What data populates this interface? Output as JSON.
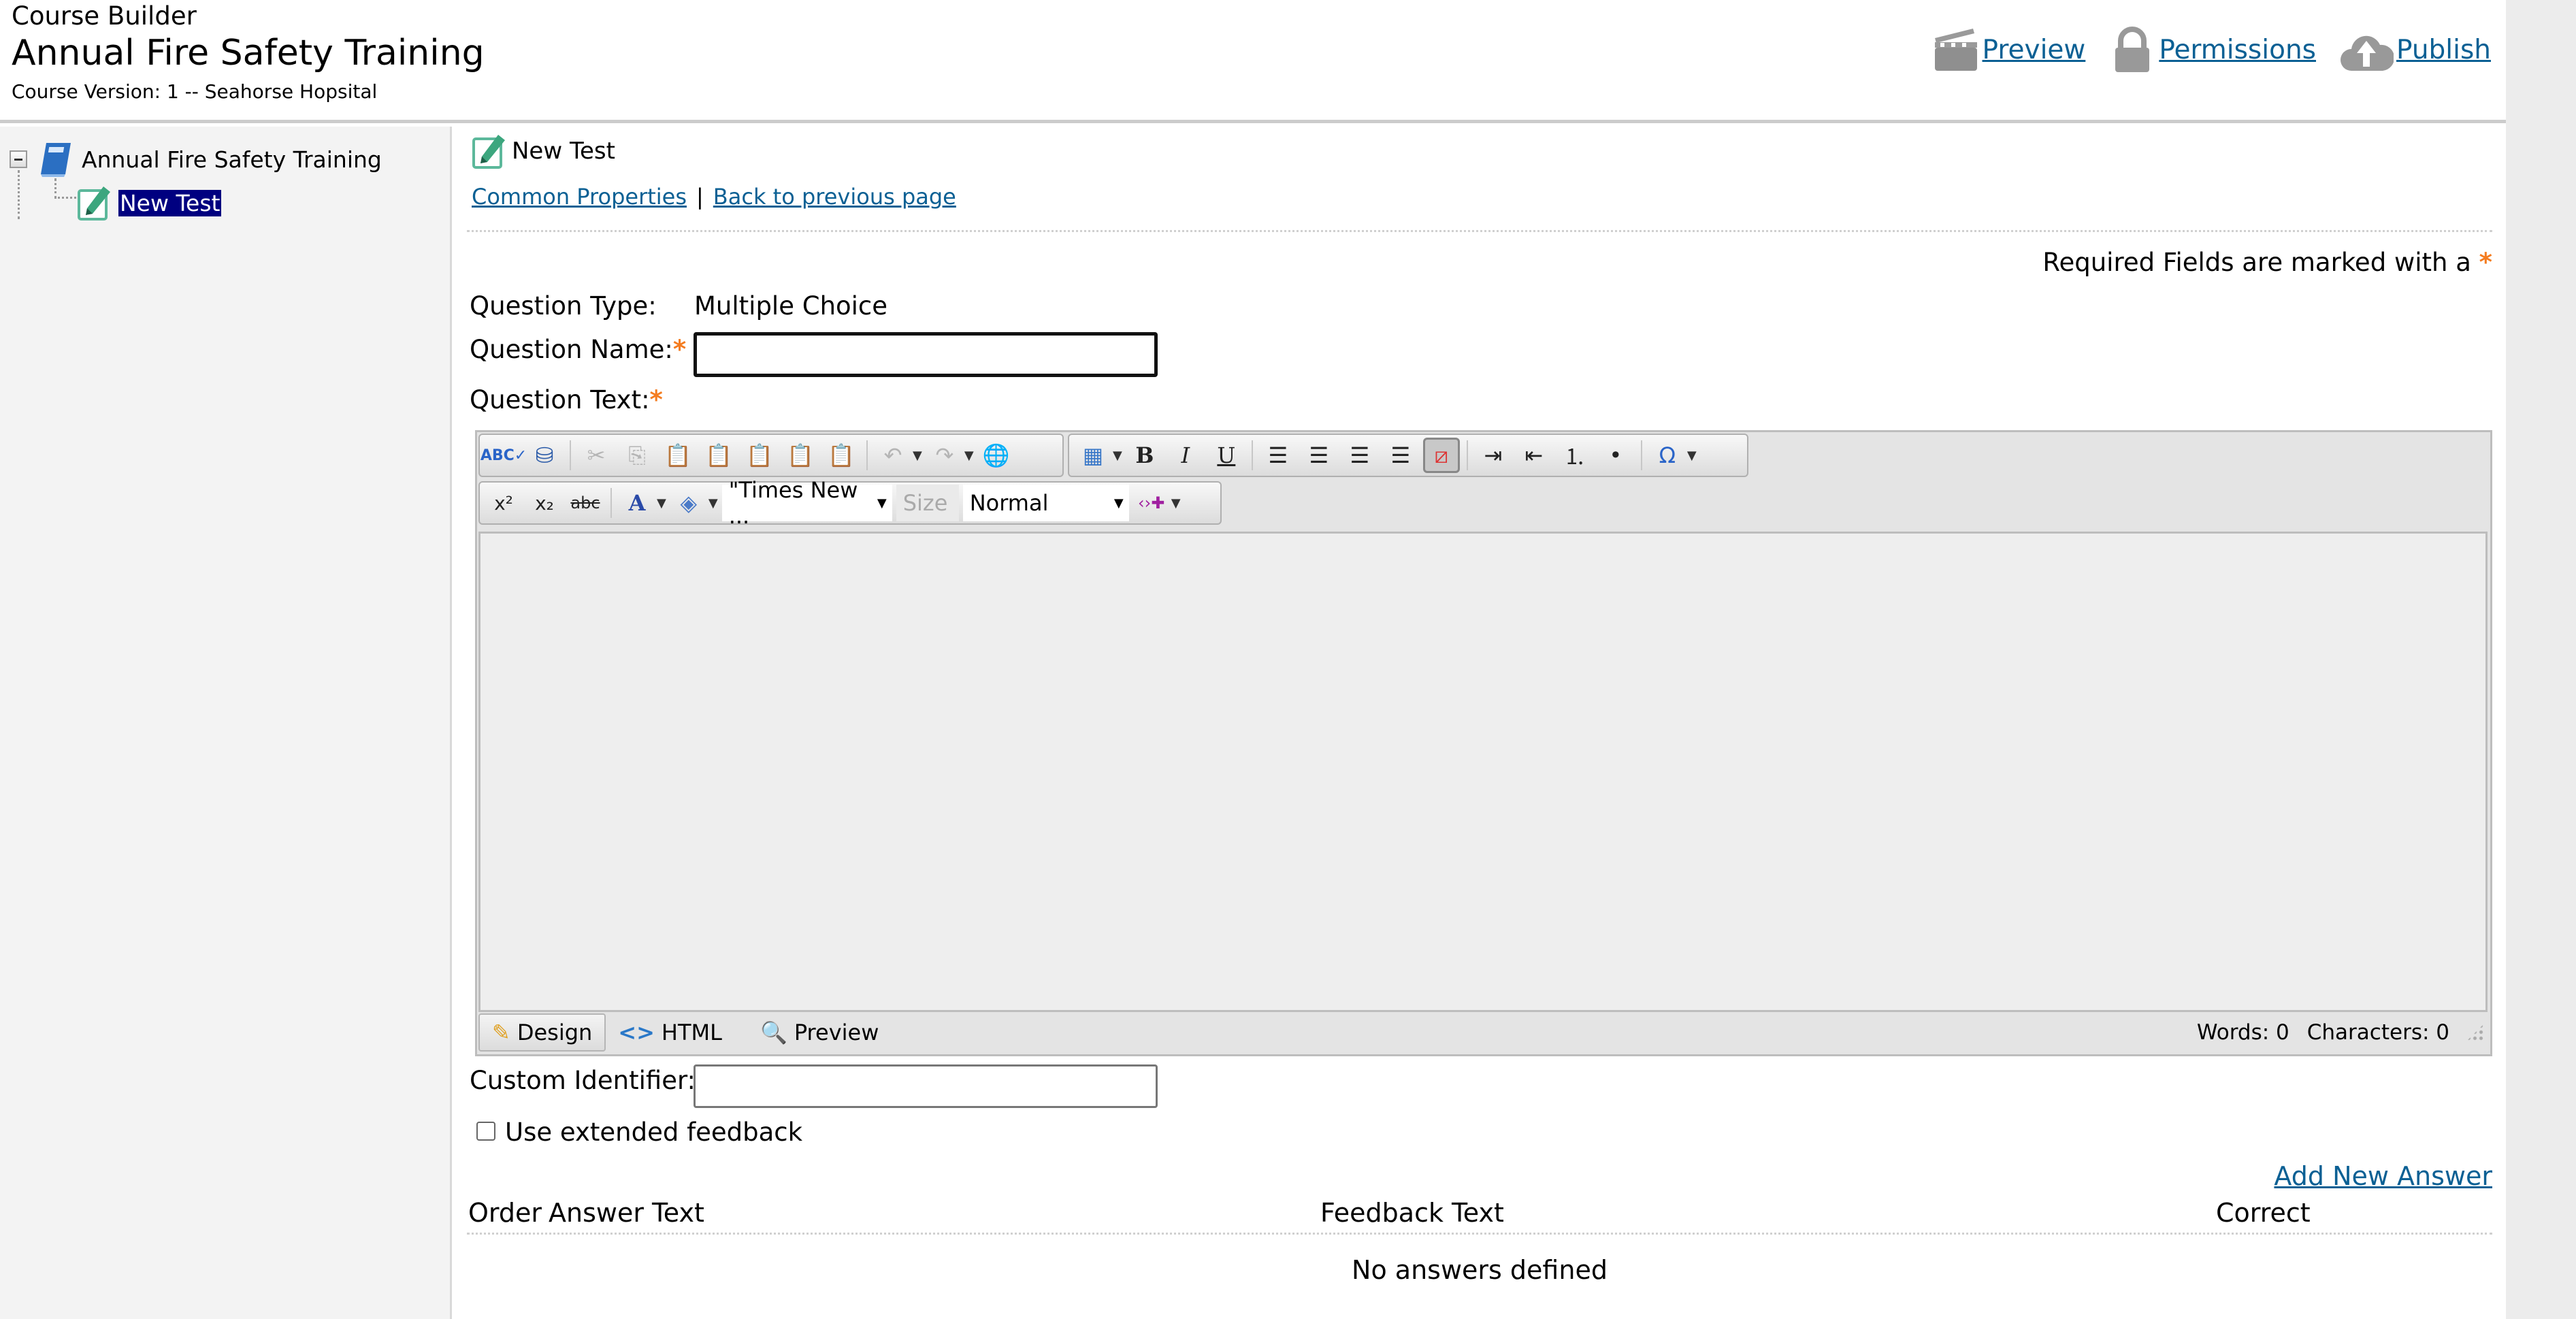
{
  "header": {
    "app_label": "Course Builder",
    "course_title": "Annual Fire Safety Training",
    "course_version": "Course Version: 1 -- Seahorse Hopsital",
    "actions": [
      {
        "label": "Preview",
        "icon": "clapperboard-icon"
      },
      {
        "label": "Permissions",
        "icon": "lock-icon"
      },
      {
        "label": "Publish",
        "icon": "cloud-upload-icon"
      }
    ]
  },
  "sidebar": {
    "tree": [
      {
        "label": "Annual Fire Safety Training",
        "icon": "book-icon",
        "expanded": true
      },
      {
        "label": "New Test",
        "icon": "test-edit-icon",
        "selected": true
      }
    ]
  },
  "main": {
    "page_title": "New Test",
    "links": {
      "common_properties": "Common Properties",
      "separator": "|",
      "back": "Back to previous page"
    },
    "required_note": "Required Fields are marked with a",
    "required_star": "*",
    "question_type_label": "Question Type:",
    "question_type_value": "Multiple Choice",
    "question_name_label": "Question Name:",
    "question_name_value": "",
    "question_text_label": "Question Text:",
    "custom_identifier_label": "Custom Identifier:",
    "custom_identifier_value": "",
    "extended_feedback_label": "Use extended feedback",
    "extended_feedback_checked": false,
    "add_answer_label": "Add New Answer",
    "answers_columns": [
      "Order",
      "Answer Text",
      "Feedback Text",
      "Correct"
    ],
    "answers_empty": "No answers defined"
  },
  "editor": {
    "font_name": "\"Times New ...",
    "size_placeholder": "Size",
    "paragraph_style": "Normal",
    "modes": [
      "Design",
      "HTML",
      "Preview"
    ],
    "active_mode": "Design",
    "words_label": "Words: 0",
    "characters_label": "Characters: 0",
    "toolbar_row1": [
      "spellcheck",
      "find-replace",
      "cut",
      "copy",
      "paste",
      "paste-from-word",
      "paste-from-word-strip-font",
      "paste-plain-text",
      "paste-as-html",
      "undo",
      "redo",
      "hyperlink-manager",
      "insert-table",
      "bold",
      "italic",
      "underline",
      "align-left",
      "align-center",
      "align-right",
      "justify",
      "remove-alignment",
      "indent",
      "outdent",
      "numbered-list",
      "bullet-list",
      "insert-symbol"
    ],
    "toolbar_row2": [
      "superscript",
      "subscript",
      "strikethrough",
      "foreground-color",
      "background-color",
      "font-name",
      "font-size",
      "paragraph-style",
      "insert-snippet"
    ]
  },
  "colors": {
    "link": "#0b6094",
    "required_star": "#f47c20",
    "selection": "#000080"
  }
}
